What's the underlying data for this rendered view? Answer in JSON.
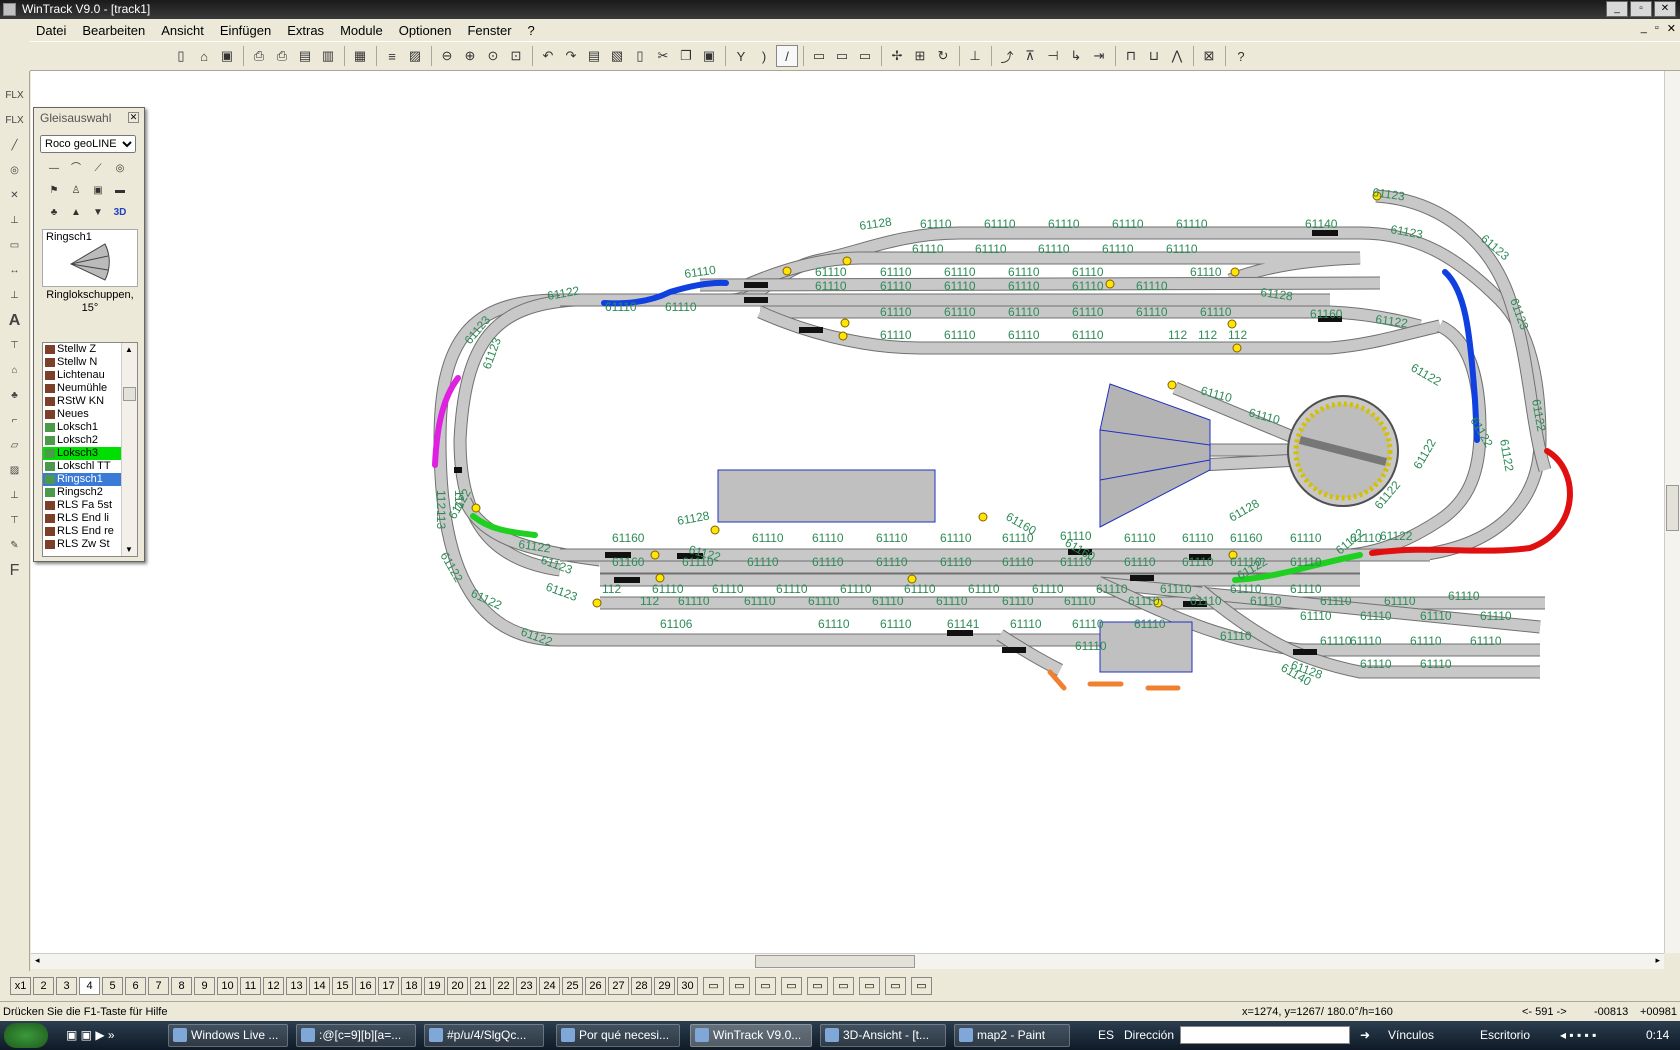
{
  "window": {
    "title": "WinTrack  V9.0 - [track1]"
  },
  "menu": [
    "Datei",
    "Bearbeiten",
    "Ansicht",
    "Einfügen",
    "Extras",
    "Module",
    "Optionen",
    "Fenster",
    "?"
  ],
  "palette": {
    "title": "Gleisauswahl",
    "system": "Roco geoLINE",
    "preview_name": "Ringsch1",
    "description": "Ringlokschuppen, 15°",
    "items": [
      "Stellw Z",
      "Stellw N",
      "Lichtenau",
      "Neumühle",
      "RStW KN",
      "Neues",
      "Loksch1",
      "Loksch2",
      "Loksch3",
      "Lokschl TT",
      "Ringsch1",
      "Ringsch2",
      "RLS Fa 5st",
      "RLS End li",
      "RLS End re",
      "RLS Zw St"
    ]
  },
  "track_labels": [
    "61110",
    "61122",
    "61123",
    "61128",
    "61140",
    "61160",
    "61106",
    "61141",
    "112",
    "113"
  ],
  "pages": [
    "x1",
    "2",
    "3",
    "4",
    "5",
    "6",
    "7",
    "8",
    "9",
    "10",
    "11",
    "12",
    "13",
    "14",
    "15",
    "16",
    "17",
    "18",
    "19",
    "20",
    "21",
    "22",
    "23",
    "24",
    "25",
    "26",
    "27",
    "28",
    "29",
    "30"
  ],
  "status": {
    "help": "Drücken Sie die  F1-Taste für Hilfe",
    "coords": "x=1274, y=1267/ 180.0°/h=160",
    "nav": "<- 591 ->",
    "off1": "-00813",
    "off2": "+00981"
  },
  "taskbar": {
    "tasks": [
      "Windows Live ...",
      ":@[c=9][b][a=...",
      "#p/u/4/SlgQc...",
      "Por qué necesi...",
      "WinTrack  V9.0...",
      "3D-Ansicht - [t...",
      "map2 - Paint"
    ],
    "lang": "ES",
    "address_label": "Dirección",
    "links": "Vínculos",
    "desktop": "Escritorio",
    "time": "0:14"
  },
  "colors": {
    "track": "#c8c8c8",
    "track_edge": "#707070",
    "label": "#2e8b57",
    "magenta": "#e020e0",
    "blue": "#1040e0",
    "green": "#20d020",
    "red": "#e01010",
    "orange": "#f08030"
  }
}
